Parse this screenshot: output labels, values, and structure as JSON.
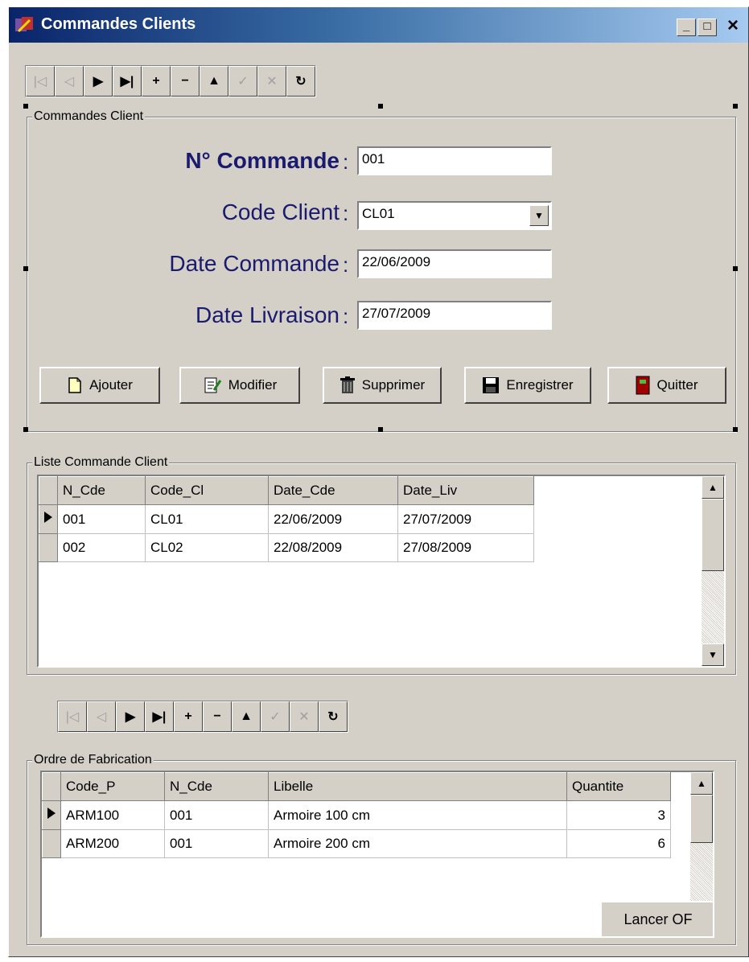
{
  "window": {
    "title": "Commandes Clients",
    "minimize": "_",
    "maximize": "□",
    "close": "×"
  },
  "nav_icons": [
    {
      "name": "first-record-icon",
      "glyph": "|◁",
      "enabled": false
    },
    {
      "name": "prior-record-icon",
      "glyph": "◁",
      "enabled": false
    },
    {
      "name": "next-record-icon",
      "glyph": "▶",
      "enabled": true
    },
    {
      "name": "last-record-icon",
      "glyph": "▶|",
      "enabled": true
    },
    {
      "name": "insert-record-icon",
      "glyph": "+",
      "enabled": true
    },
    {
      "name": "delete-record-icon",
      "glyph": "−",
      "enabled": true
    },
    {
      "name": "edit-record-icon",
      "glyph": "▲",
      "enabled": true
    },
    {
      "name": "post-edit-icon",
      "glyph": "✓",
      "enabled": false
    },
    {
      "name": "cancel-edit-icon",
      "glyph": "✕",
      "enabled": false
    },
    {
      "name": "refresh-icon",
      "glyph": "↻",
      "enabled": true
    }
  ],
  "commande_group": {
    "legend": "Commandes Client",
    "fields": {
      "n_commande": {
        "label": "N° Commande",
        "value": "001"
      },
      "code_client": {
        "label": "Code Client",
        "value": "CL01"
      },
      "date_commande": {
        "label": "Date Commande",
        "value": "22/06/2009"
      },
      "date_livraison": {
        "label": "Date Livraison",
        "value": "27/07/2009"
      }
    },
    "colon": ":",
    "buttons": {
      "ajouter": "Ajouter",
      "modifier": "Modifier",
      "supprimer": "Supprimer",
      "enregistrer": "Enregistrer",
      "quitter": "Quitter"
    }
  },
  "liste_group": {
    "legend": "Liste Commande Client",
    "columns": [
      "N_Cde",
      "Code_Cl",
      "Date_Cde",
      "Date_Liv"
    ],
    "rows": [
      [
        "001",
        "CL01",
        "22/06/2009",
        "27/07/2009"
      ],
      [
        "002",
        "CL02",
        "22/08/2009",
        "27/08/2009"
      ]
    ]
  },
  "ordre_group": {
    "legend": "Ordre de Fabrication",
    "columns": [
      "Code_P",
      "N_Cde",
      "Libelle",
      "Quantite"
    ],
    "rows": [
      [
        "ARM100",
        "001",
        "Armoire 100 cm",
        "3"
      ],
      [
        "ARM200",
        "001",
        "Armoire 200 cm",
        "6"
      ]
    ],
    "lancer_button": "Lancer OF"
  },
  "colors": {
    "title_gradient_start": "#0a246a",
    "title_gradient_end": "#a6caf0",
    "face": "#d4d0c8",
    "label_text": "#1a1a6e"
  }
}
